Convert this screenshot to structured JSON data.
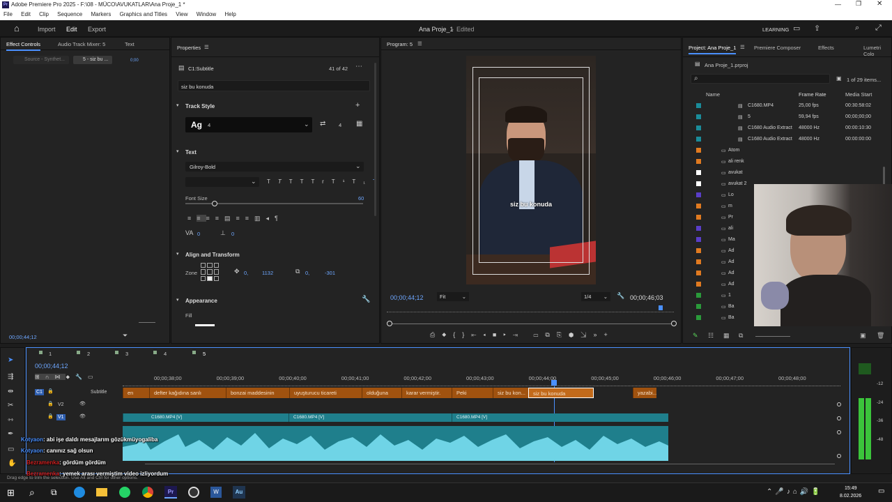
{
  "window": {
    "title": "Adobe Premiere Pro 2025 - F:\\08 - MÜCO\\AVUKATLAR\\Ana Proje_1 *"
  },
  "menu": [
    "File",
    "Edit",
    "Clip",
    "Sequence",
    "Markers",
    "Graphics and Titles",
    "View",
    "Window",
    "Help"
  ],
  "workspace": {
    "import": "Import",
    "edit": "Edit",
    "export": "Export",
    "project_title": "Ana Proje_1",
    "status": "Edited",
    "learning": "LEARNING"
  },
  "left": {
    "tab1": "Effect Controls",
    "tab2": "Audio Track Mixer: 5",
    "tab3": "Text",
    "source": "Source - Synthet...",
    "seq": "5 - siz bu ...",
    "timecode": "00;00;44;12"
  },
  "properties": {
    "tab": "Properties",
    "clip": "C1:Subtitle",
    "count": "41 of 42",
    "text": "siz bu konuda",
    "track_style": "Track Style",
    "style_name": "4",
    "style_num": "4",
    "text_hdr": "Text",
    "font": "Gilroy-Bold",
    "font_size_label": "Font Size",
    "font_size": "60",
    "tracking": "0",
    "kern": "0",
    "align_hdr": "Align and Transform",
    "zone": "Zone",
    "pos_x": "0,",
    "pos_y": "1132",
    "scale_x": "0,",
    "scale_y": "-301",
    "appearance": "Appearance",
    "fill": "Fill"
  },
  "program": {
    "title": "Program: 5",
    "caption": "siz bu konuda",
    "timecode": "00;00;44;12",
    "fit": "Fit",
    "ratio": "1/4",
    "duration": "00;00;46;03"
  },
  "project": {
    "tab": "Project: Ana Proje_1",
    "tab2": "Premiere Composer",
    "tab3": "Effects",
    "tab4": "Lumetri Colo",
    "file": "Ana Proje_1.prproj",
    "items_count": "1 of 29 items...",
    "col_name": "Name",
    "col_fps": "Frame Rate",
    "col_start": "Media Start",
    "rows": [
      {
        "name": "C1680.MP4",
        "fps": "25,00 fps",
        "start": "00:30:58:02",
        "color": "#1a8c9a"
      },
      {
        "name": "5",
        "fps": "59,94 fps",
        "start": "00;00;00;00",
        "color": "#1a8c9a"
      },
      {
        "name": "C1680 Audio Extract",
        "fps": "48000 Hz",
        "start": "00:00:10:30",
        "color": "#1a8c9a"
      },
      {
        "name": "C1680 Audio Extract",
        "fps": "48000 Hz",
        "start": "00:00:00:00",
        "color": "#1a8c9a"
      },
      {
        "name": "Atom",
        "fps": "",
        "start": "",
        "color": "#e07a20"
      },
      {
        "name": "ali renk",
        "fps": "",
        "start": "",
        "color": "#e07a20"
      },
      {
        "name": "avukat",
        "fps": "",
        "start": "",
        "color": "#ffffff"
      },
      {
        "name": "avukat 2",
        "fps": "",
        "start": "",
        "color": "#ffffff"
      },
      {
        "name": "Lo",
        "fps": "",
        "start": "",
        "color": "#5a3ec8"
      },
      {
        "name": "m",
        "fps": "",
        "start": "",
        "color": "#e07a20"
      },
      {
        "name": "Pr",
        "fps": "",
        "start": "",
        "color": "#e07a20"
      },
      {
        "name": "ali",
        "fps": "",
        "start": "",
        "color": "#5a3ec8"
      },
      {
        "name": "Ma",
        "fps": "",
        "start": "",
        "color": "#5a3ec8"
      },
      {
        "name": "Ad",
        "fps": "",
        "start": "",
        "color": "#e07a20"
      },
      {
        "name": "Ad",
        "fps": "",
        "start": "",
        "color": "#e07a20"
      },
      {
        "name": "Ad",
        "fps": "",
        "start": "",
        "color": "#e07a20"
      },
      {
        "name": "Ad",
        "fps": "",
        "start": "",
        "color": "#e07a20"
      },
      {
        "name": "1",
        "fps": "",
        "start": "",
        "color": "#2a9a3a"
      },
      {
        "name": "Ba",
        "fps": "",
        "start": "",
        "color": "#2a9a3a"
      },
      {
        "name": "Ba",
        "fps": "",
        "start": "",
        "color": "#2a9a3a"
      }
    ]
  },
  "timeline": {
    "timecode": "00;00;44;12",
    "tabs": [
      "1",
      "2",
      "3",
      "4",
      "5"
    ],
    "ticks": [
      "00;00;38;00",
      "00;00;39;00",
      "00;00;40;00",
      "00;00;41;00",
      "00;00;42;00",
      "00;00;43;00",
      "00;00;44;00",
      "00;00;45;00",
      "00;00;46;00",
      "00;00;47;00",
      "00;00;48;00"
    ],
    "subtitle_label": "Subtitle",
    "v2": "V2",
    "v1": "V1",
    "c1": "C1",
    "subtitles": [
      "en",
      "defter kağıdına sanlı",
      "bonzai maddesinin",
      "uyuşturucu ticareti",
      "olduğuna",
      "karar vermiştir.",
      "Peki",
      "siz bu kon...",
      "siz bu konuda",
      "yazabi..."
    ],
    "video_clips": [
      "C1680.MP4 [V]",
      "C1680.MP4 [V]",
      "C1680.MP4 [V]"
    ],
    "meter": [
      "-12",
      "-24",
      "-36",
      "-48"
    ],
    "status": "Drag edge to trim the selection. Use Alt and Ctrl for other options."
  },
  "chat": [
    {
      "user": "Kotyaon",
      "msg": ": abi işe daldı mesajlarım gözükmüyogaliba"
    },
    {
      "user": "Kotyaon",
      "msg": ": canınız sağ olsun"
    },
    {
      "user": "Bezramenka",
      "msg": ": gördüm gördüm"
    },
    {
      "user": "Bezramenka",
      "msg": ": yemek arası vermiştim video izliyordum"
    }
  ],
  "taskbar": {
    "time": "15:49",
    "date": "8.02.2026"
  }
}
